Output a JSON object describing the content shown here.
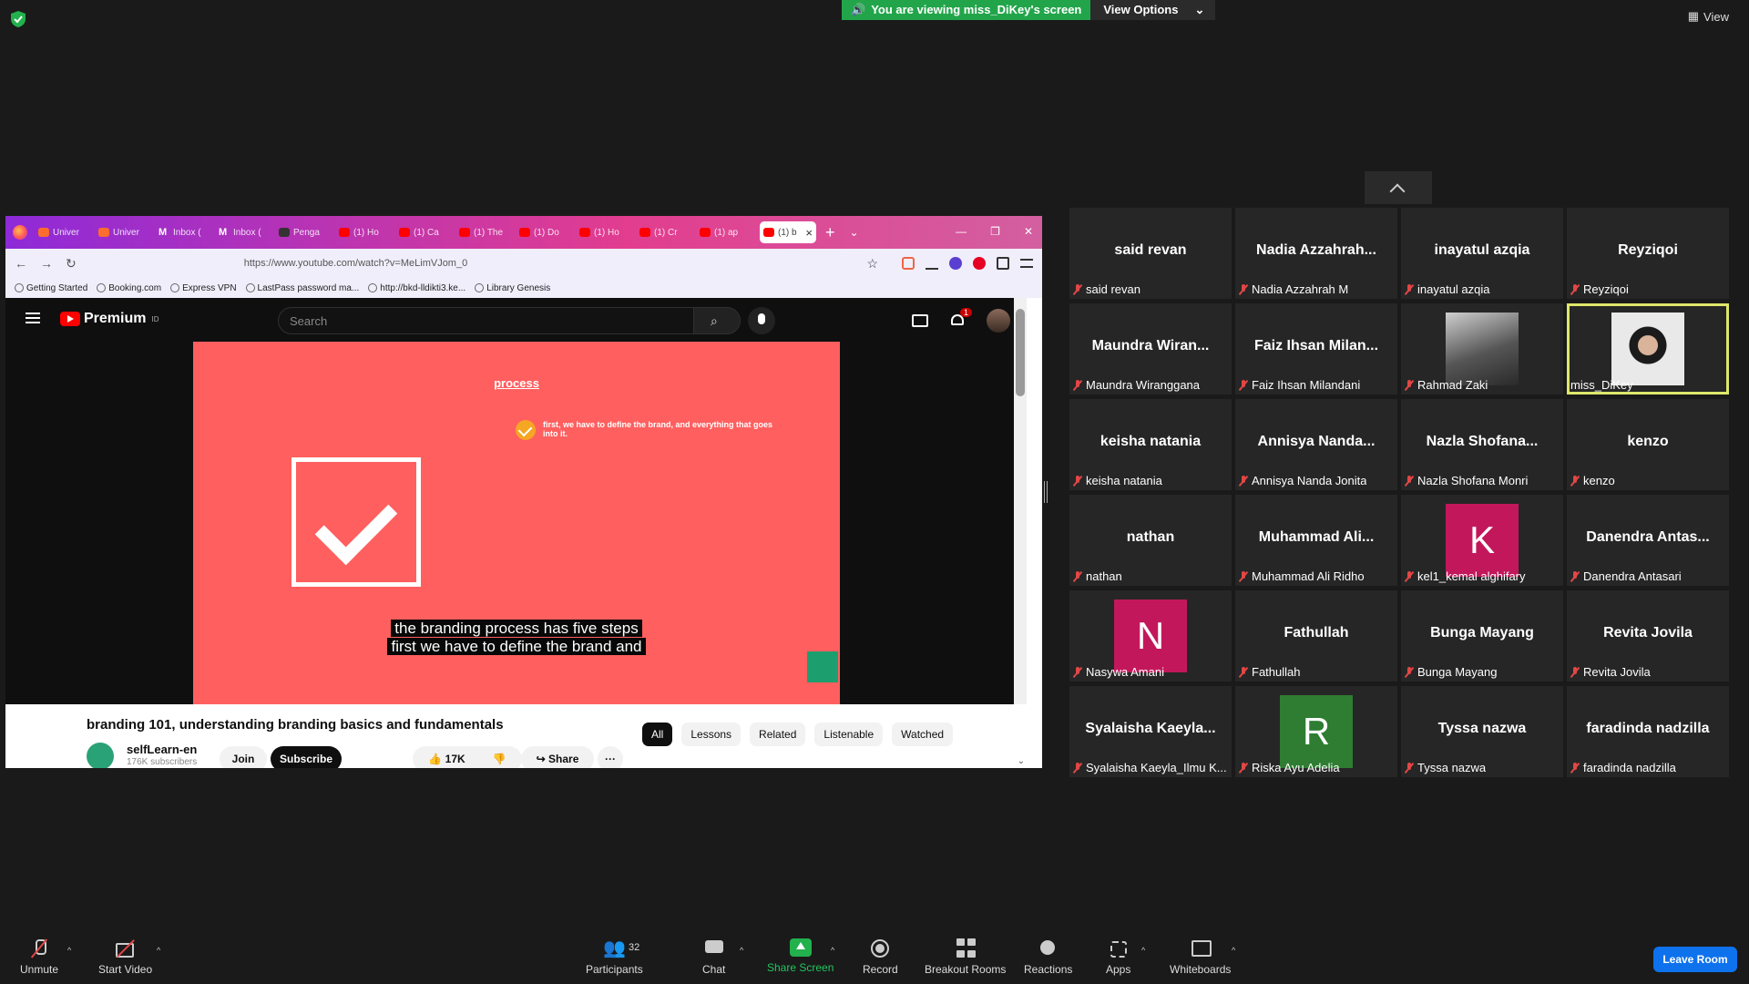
{
  "meeting": {
    "viewing_banner": "You are viewing miss_DiKey's screen",
    "view_options": "View Options",
    "top_view": "View"
  },
  "browser": {
    "tabs": [
      {
        "label": "Univer",
        "icon": "university-icon"
      },
      {
        "label": "Univer",
        "icon": "university-icon"
      },
      {
        "label": "Inbox (",
        "icon": "gmail-icon"
      },
      {
        "label": "Inbox (",
        "icon": "gmail-icon"
      },
      {
        "label": "Penga",
        "icon": "page-icon"
      },
      {
        "label": "(1) Ho",
        "icon": "youtube-icon"
      },
      {
        "label": "(1) Ca",
        "icon": "youtube-icon"
      },
      {
        "label": "(1) The",
        "icon": "youtube-icon"
      },
      {
        "label": "(1) Do",
        "icon": "youtube-icon"
      },
      {
        "label": "(1) Ho",
        "icon": "youtube-icon"
      },
      {
        "label": "(1) Cr",
        "icon": "youtube-icon"
      },
      {
        "label": "(1) ap",
        "icon": "youtube-icon"
      }
    ],
    "active_tab": "(1) b",
    "url": "https://www.youtube.com/watch?v=MeLimVJom_0",
    "bookmarks": [
      "Getting Started",
      "Booking.com",
      "Express VPN",
      "LastPass password ma...",
      "http://bkd-lldikti3.ke...",
      "Library Genesis"
    ]
  },
  "youtube": {
    "logo": "Premium",
    "logo_region": "ID",
    "search_placeholder": "Search",
    "notification_count": "1",
    "slide_title": "process",
    "slide_bullet": "first, we have to define the brand, and everything that goes into it.",
    "caption_line1": "the branding process has five steps",
    "caption_line2": "first we have to define the brand and",
    "video_title": "branding 101, understanding branding basics and fundamentals",
    "channel_name": "selfLearn-en",
    "channel_subs": "176K subscribers",
    "join": "Join",
    "subscribe": "Subscribe",
    "likes": "17K",
    "share": "Share",
    "more": "···",
    "chips": [
      "All",
      "Lessons",
      "Related",
      "Listenable",
      "Watched"
    ]
  },
  "participants": [
    {
      "big": "said revan",
      "label": "said revan",
      "type": "name"
    },
    {
      "big": "Nadia  Azzahrah...",
      "label": "Nadia Azzahrah M",
      "type": "name"
    },
    {
      "big": "inayatul azqia",
      "label": "inayatul azqia",
      "type": "name"
    },
    {
      "big": "Reyziqoi",
      "label": "Reyziqoi",
      "type": "name"
    },
    {
      "big": "Maundra  Wiran...",
      "label": "Maundra Wiranggana",
      "type": "name"
    },
    {
      "big": "Faiz Ihsan  Milan...",
      "label": "Faiz Ihsan Milandani",
      "type": "name"
    },
    {
      "big": "",
      "label": "Rahmad Zaki",
      "type": "photo-group"
    },
    {
      "big": "",
      "label": "miss_DiKey",
      "type": "photo-person",
      "speaking": true
    },
    {
      "big": "keisha natania",
      "label": "keisha natania",
      "type": "name"
    },
    {
      "big": "Annisya  Nanda...",
      "label": "Annisya Nanda Jonita",
      "type": "name"
    },
    {
      "big": "Nazla  Shofana...",
      "label": "Nazla Shofana Monri",
      "type": "name"
    },
    {
      "big": "kenzo",
      "label": "kenzo",
      "type": "name"
    },
    {
      "big": "nathan",
      "label": "nathan",
      "type": "name"
    },
    {
      "big": "Muhammad  Ali...",
      "label": "Muhammad Ali Ridho",
      "type": "name"
    },
    {
      "big": "K",
      "label": "kel1_kemal alghifary",
      "type": "letter",
      "color": "#c2185b"
    },
    {
      "big": "Danendra  Antas...",
      "label": "Danendra Antasari",
      "type": "name"
    },
    {
      "big": "N",
      "label": "Nasywa Amani",
      "type": "letter",
      "color": "#c2185b"
    },
    {
      "big": "Fathullah",
      "label": "Fathullah",
      "type": "name"
    },
    {
      "big": "Bunga Mayang",
      "label": "Bunga Mayang",
      "type": "name"
    },
    {
      "big": "Revita Jovila",
      "label": "Revita Jovila",
      "type": "name"
    },
    {
      "big": "Syalaisha  Kaeyla...",
      "label": "Syalaisha Kaeyla_Ilmu K...",
      "type": "name"
    },
    {
      "big": "R",
      "label": "Riska Ayu Adelia",
      "type": "letter",
      "color": "#2e7d32"
    },
    {
      "big": "Tyssa nazwa",
      "label": "Tyssa nazwa",
      "type": "name"
    },
    {
      "big": "faradinda nadzilla",
      "label": "faradinda nadzilla",
      "type": "name"
    }
  ],
  "toolbar": {
    "unmute": "Unmute",
    "start_video": "Start Video",
    "participants": "Participants",
    "participants_count": "32",
    "chat": "Chat",
    "share_screen": "Share Screen",
    "record": "Record",
    "breakout": "Breakout Rooms",
    "reactions": "Reactions",
    "apps": "Apps",
    "whiteboards": "Whiteboards",
    "leave": "Leave Room"
  },
  "colors": {
    "banner_green": "#22a54a",
    "slide_red": "#ff5f5f",
    "speaking_outline": "#dfe66a",
    "leave_blue": "#0e72ed"
  }
}
